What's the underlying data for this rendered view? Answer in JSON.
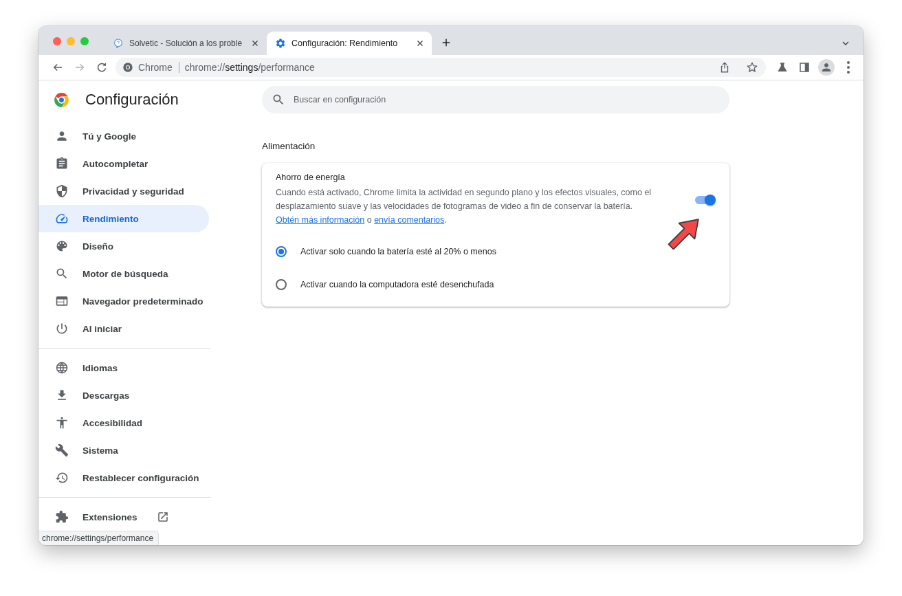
{
  "window": {
    "tabs": [
      {
        "title": "Solvetic - Solución a los proble",
        "selected": false
      },
      {
        "title": "Configuración: Rendimiento",
        "selected": true
      }
    ]
  },
  "toolbar": {
    "site_chip": "Chrome",
    "url": {
      "scheme": "chrome://",
      "host": "settings",
      "path": "/performance"
    }
  },
  "sidebar": {
    "title": "Configuración",
    "groups": [
      [
        {
          "label": "Tú y Google",
          "selected": false
        },
        {
          "label": "Autocompletar",
          "selected": false
        },
        {
          "label": "Privacidad y seguridad",
          "selected": false
        },
        {
          "label": "Rendimiento",
          "selected": true
        },
        {
          "label": "Diseño",
          "selected": false
        },
        {
          "label": "Motor de búsqueda",
          "selected": false
        },
        {
          "label": "Navegador predeterminado",
          "selected": false
        },
        {
          "label": "Al iniciar",
          "selected": false
        }
      ],
      [
        {
          "label": "Idiomas",
          "selected": false
        },
        {
          "label": "Descargas",
          "selected": false
        },
        {
          "label": "Accesibilidad",
          "selected": false
        },
        {
          "label": "Sistema",
          "selected": false
        },
        {
          "label": "Restablecer configuración",
          "selected": false
        }
      ],
      [
        {
          "label": "Extensiones",
          "selected": false
        }
      ]
    ]
  },
  "search": {
    "placeholder": "Buscar en configuración"
  },
  "section": {
    "title": "Alimentación",
    "card": {
      "title": "Ahorro de energía",
      "on": true,
      "description": [
        {
          "kind": "text",
          "text": "Cuando está activado, Chrome limita la actividad en segundo plano y los efectos visuales, como el desplazamiento suave y las velocidades de fotogramas de video a fin de conservar la batería. "
        },
        {
          "kind": "link",
          "text": "Obtén más información"
        },
        {
          "kind": "text",
          "text": " o "
        },
        {
          "kind": "link",
          "text": "envía comentarios"
        },
        {
          "kind": "text",
          "text": "."
        }
      ],
      "options": [
        {
          "label": "Activar solo cuando la batería esté al 20% o menos",
          "selected": true
        },
        {
          "label": "Activar cuando la computadora esté desenchufada",
          "selected": false
        }
      ]
    }
  },
  "status_bar": {
    "url": "chrome://settings/performance"
  }
}
